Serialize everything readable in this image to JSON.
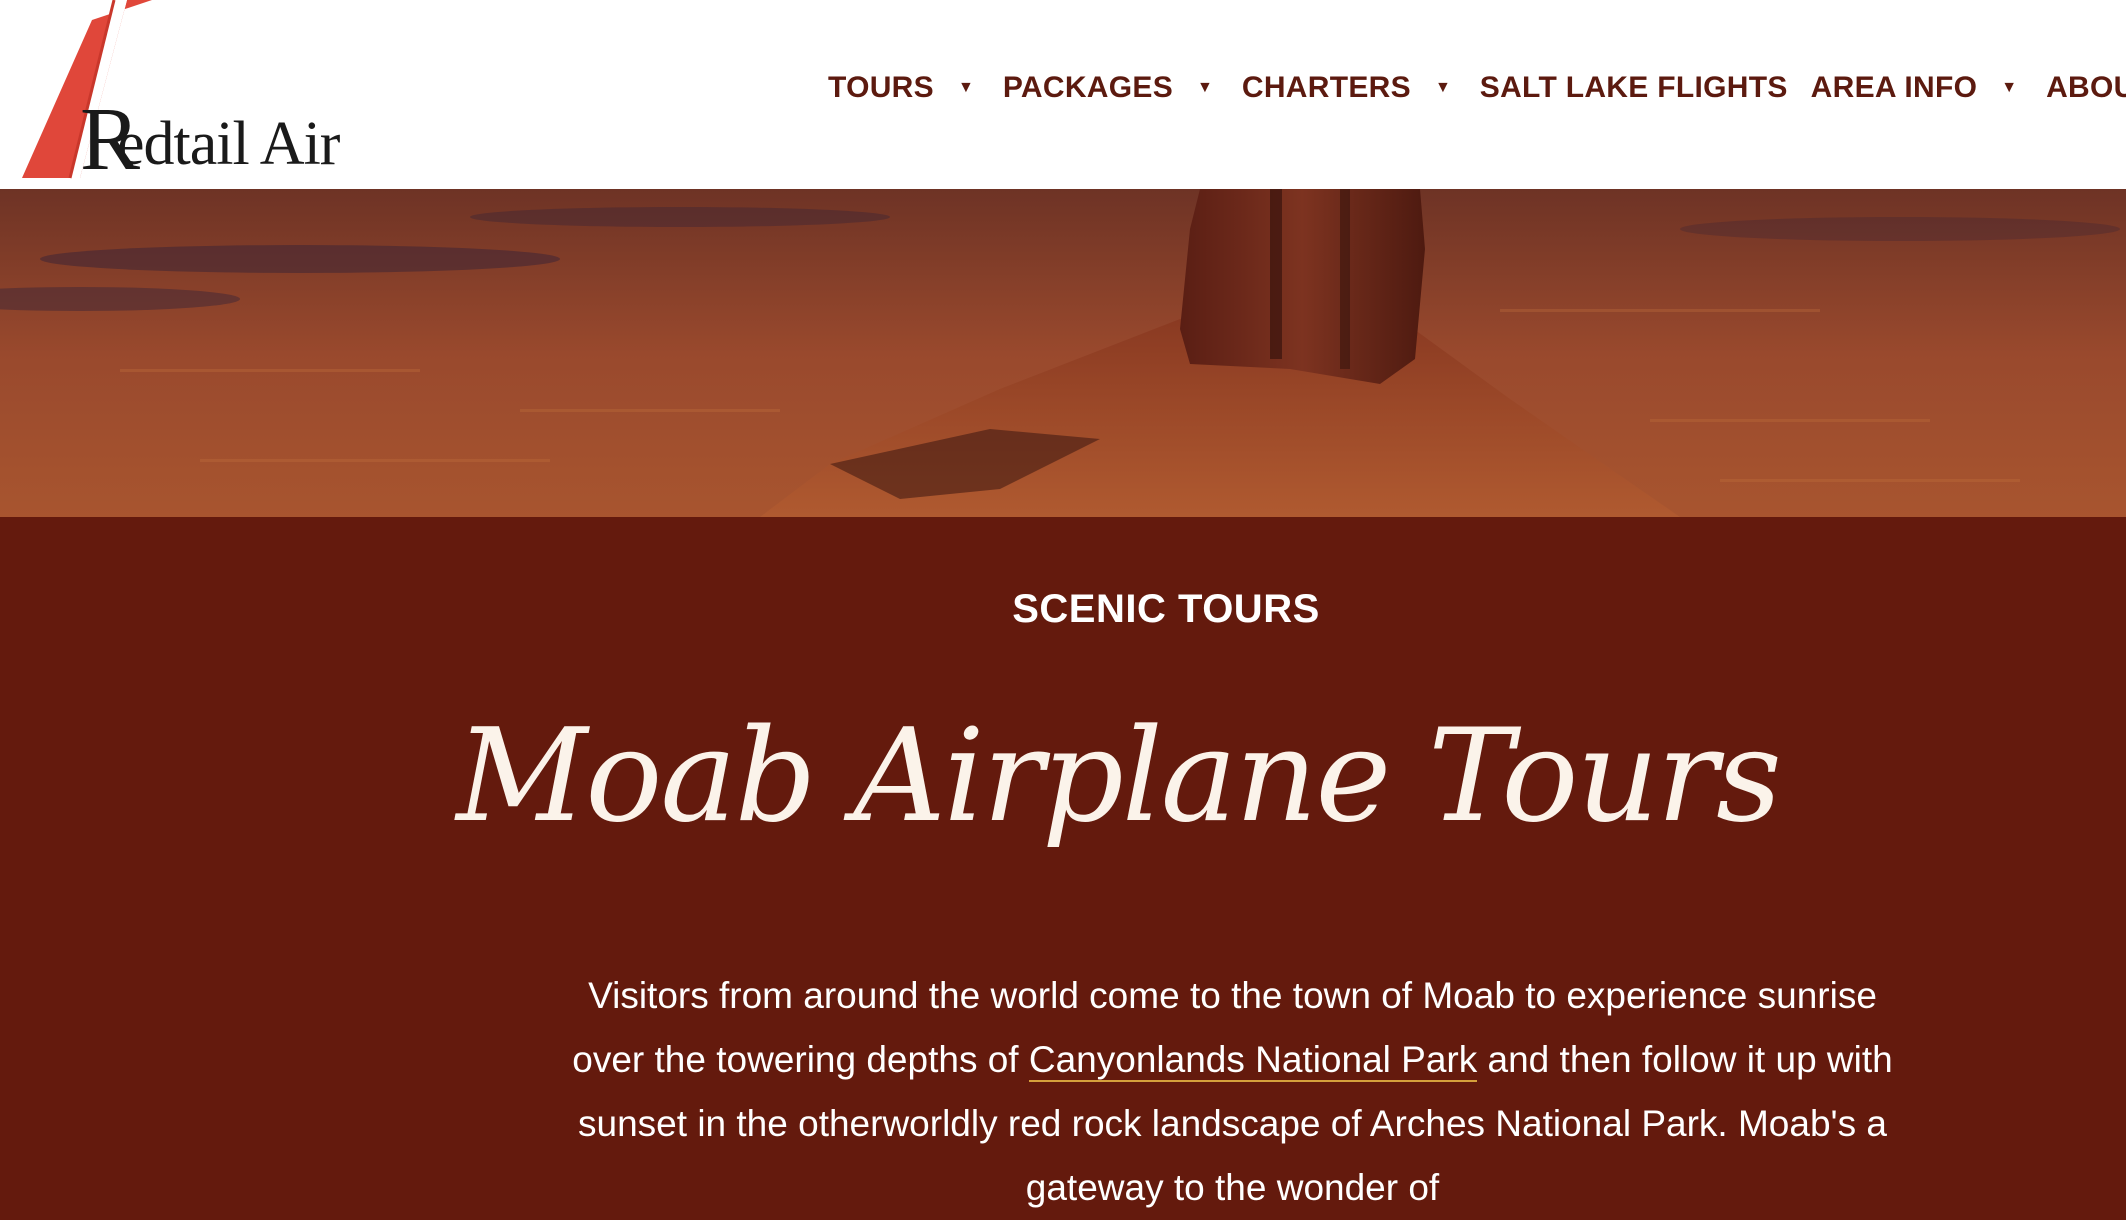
{
  "brand": {
    "name": "Redtail Air",
    "logo_colors": {
      "accent": "#e0473a",
      "text": "#1a1a1a"
    }
  },
  "nav": {
    "items": [
      {
        "label": "TOURS",
        "has_dropdown": true
      },
      {
        "label": "PACKAGES",
        "has_dropdown": true
      },
      {
        "label": "CHARTERS",
        "has_dropdown": true
      },
      {
        "label": "SALT LAKE FLIGHTS",
        "has_dropdown": false
      },
      {
        "label": "AREA INFO",
        "has_dropdown": true
      },
      {
        "label": "ABOUT",
        "has_dropdown": false
      }
    ],
    "dropdown_icon": "caret-down-icon"
  },
  "hero": {
    "image": "desert-butte-aerial"
  },
  "section": {
    "eyebrow": "SCENIC TOURS",
    "title": "Moab Airplane Tours",
    "intro_part1": "Visitors from around the world come to the town of Moab to experience sunrise over the towering depths of ",
    "intro_link": "Canyonlands National Park",
    "intro_part2": " and then follow it up with sunset in the otherworldly red rock landscape of Arches National Park. Moab's a gateway to the wonder of"
  },
  "colors": {
    "background": "#641a0d",
    "nav_text": "#5c1a0f",
    "link_underline": "#d6a13c"
  }
}
